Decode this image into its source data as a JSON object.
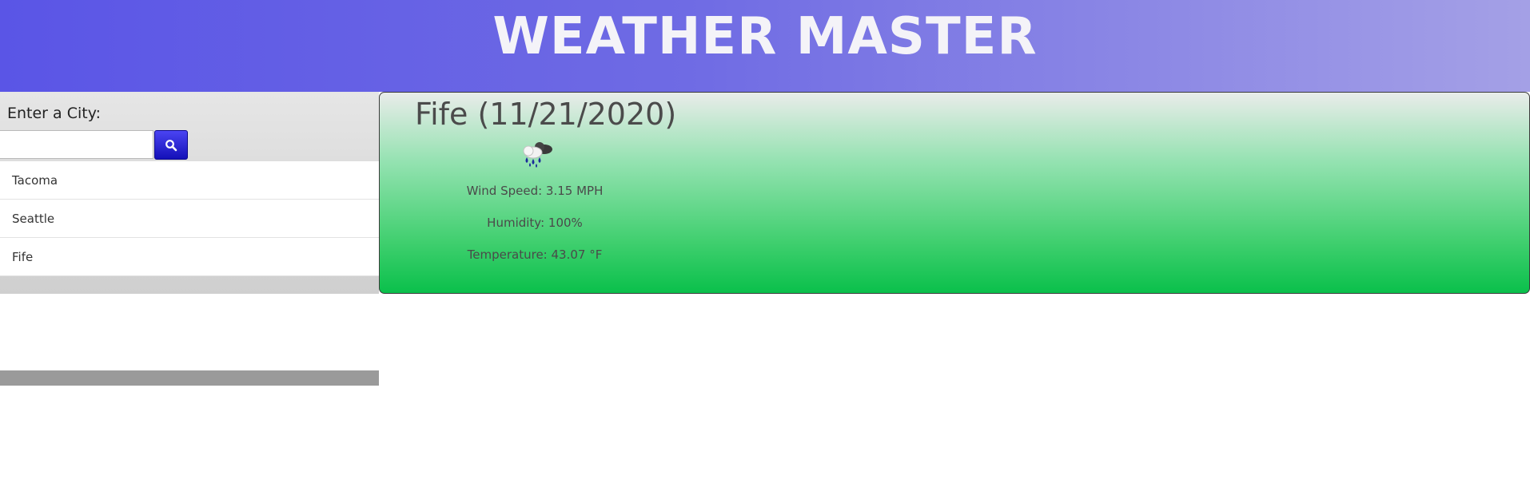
{
  "app": {
    "title": "WEATHER MASTER"
  },
  "search": {
    "label": "Enter a City:",
    "value": "",
    "placeholder": "",
    "button_icon": "search-icon"
  },
  "history": [
    {
      "label": "Tacoma"
    },
    {
      "label": "Seattle"
    },
    {
      "label": "Fife"
    }
  ],
  "current": {
    "heading": "Fife (11/21/2020)",
    "icon": "rain-cloud-icon",
    "wind": "Wind Speed: 3.15 MPH",
    "humidity": "Humidity: 100%",
    "temperature": "Temperature: 43.07 °F"
  },
  "colors": {
    "header_start": "#5a55e6",
    "header_end": "#a4a0e6",
    "button": "#1410b8",
    "card_top": "#e9ecea",
    "card_bottom": "#0ac04b"
  }
}
